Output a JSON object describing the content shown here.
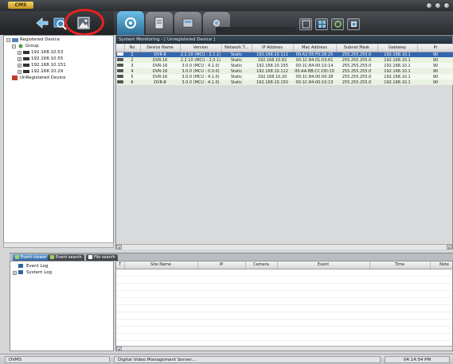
{
  "app": {
    "logo": "CMS"
  },
  "left_toolbar": {
    "buttons": [
      "arrow-icon",
      "search-icon",
      "image-icon"
    ]
  },
  "main_tabs": [
    "monitoring-tab",
    "document-tab",
    "storage-tab",
    "settings-tab"
  ],
  "view_buttons": [
    "single-view-icon",
    "quad-view-icon",
    "refresh-icon",
    "settings-view-icon"
  ],
  "device_tree": {
    "registered_label": "Registered Device",
    "group_label": "Group",
    "devices": [
      "192.168.10.53",
      "192.168.10.55",
      "192.168.10.151",
      "192.168.10.29"
    ],
    "unregistered_label": "UnRegistered Device"
  },
  "monitor": {
    "title": "System Monitoring - [ Unregistered Device ]",
    "columns": [
      "No",
      "Device Name",
      "Version",
      "Network T...",
      "IP Address",
      "Mac Address",
      "Subnet Mask",
      "Gateway",
      "Pr"
    ],
    "rows": [
      [
        "2",
        "DVR-8",
        "2.2.10 (MCU : 2.1.1)",
        "Static",
        "192.168.10.111",
        "00:A2:55:F0:28:25",
        "255.255.255.0",
        "192.168.10.1",
        "90"
      ],
      [
        "2",
        "DVR-16",
        "2.2.10 (MCU : 2.0.1)",
        "Static",
        "192.168.10.82",
        "00:1C:84:01:03:61",
        "255.255.255.0",
        "192.168.10.1",
        "90"
      ],
      [
        "3",
        "DVR-16",
        "3.0.0 (MCU : 4.1.0)",
        "Static",
        "192.168.10.155",
        "00:1C:84:00:10:14",
        "255.255.255.0",
        "192.168.10.1",
        "90"
      ],
      [
        "4",
        "DVR-16",
        "3.0.0 (MCU : 0.0.0)",
        "Static",
        "192.168.10.112",
        "00:AA:BB:CC:DD:10",
        "255.255.255.0",
        "192.168.10.1",
        "90"
      ],
      [
        "5",
        "DVR-16",
        "3.0.0 (MCU : 4.1.0)",
        "Static",
        "192.168.10.20",
        "00:1C:84:00:00:28",
        "255.255.255.0",
        "192.168.10.1",
        "90"
      ],
      [
        "6",
        "DVR-8",
        "3.0.0 (MCU : 4.1.0)",
        "Static",
        "192.168.10.150",
        "00:1C:84:00:10:13",
        "255.255.255.0",
        "192.168.10.1",
        "90"
      ]
    ],
    "selected_row": 0
  },
  "bottom_tabs": [
    "Event viewer",
    "Event search",
    "File search"
  ],
  "event_tree": {
    "event_log": "Event Log",
    "system_log": "System Log"
  },
  "log_table": {
    "columns": [
      "T",
      "Site Name",
      "IP",
      "Camera",
      "Event",
      "Time",
      "Note"
    ]
  },
  "status": {
    "left": "DVMS",
    "middle": "Digital Video Management Server....",
    "time": "04:14:54 PM"
  },
  "colors": {
    "selection": "#3567b0",
    "row_alt": "#e9f2e2",
    "highlight_ring": "#e8231f",
    "active_tab": "#4a9ccc"
  }
}
